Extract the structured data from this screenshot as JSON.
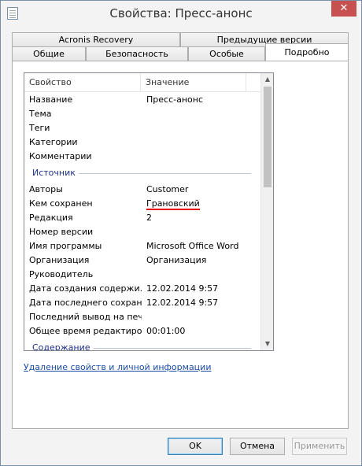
{
  "window": {
    "title": "Свойства: Пресс-анонс",
    "close_label": "✕"
  },
  "tabs": {
    "row1": [
      {
        "label": "Acronis Recovery"
      },
      {
        "label": "Предыдущие версии"
      }
    ],
    "row2": [
      {
        "label": "Общие"
      },
      {
        "label": "Безопасность"
      },
      {
        "label": "Особые"
      },
      {
        "label": "Подробно",
        "active": true
      }
    ]
  },
  "list": {
    "columns": {
      "property": "Свойство",
      "value": "Значение"
    },
    "items": [
      {
        "key": "Название",
        "value": "Пресс-анонс"
      },
      {
        "key": "Тема",
        "value": ""
      },
      {
        "key": "Теги",
        "value": ""
      },
      {
        "key": "Категории",
        "value": ""
      },
      {
        "key": "Комментарии",
        "value": ""
      }
    ],
    "group_source": "Источник",
    "source_items": [
      {
        "key": "Авторы",
        "value": "Customer"
      },
      {
        "key": "Кем сохранен",
        "value": "Грановский"
      },
      {
        "key": "Редакция",
        "value": "2"
      },
      {
        "key": "Номер версии",
        "value": ""
      },
      {
        "key": "Имя программы",
        "value": "Microsoft Office Word"
      },
      {
        "key": "Организация",
        "value": "Организация"
      },
      {
        "key": "Руководитель",
        "value": ""
      },
      {
        "key": "Дата создания содержи...",
        "value": "12.02.2014 9:57"
      },
      {
        "key": "Дата последнего сохран...",
        "value": "12.02.2014 9:57"
      },
      {
        "key": "Последний вывод на печ...",
        "value": ""
      },
      {
        "key": "Общее время редактиро...",
        "value": "00:01:00"
      }
    ],
    "group_content": "Содержание"
  },
  "remove_link": "Удаление свойств и личной информации",
  "buttons": {
    "ok": "OK",
    "cancel": "Отмена",
    "apply": "Применить"
  },
  "colors": {
    "group_text": "#1e3287",
    "link": "#1c4ba3",
    "annotation": "#e60000",
    "close_bg": "#c75050"
  }
}
